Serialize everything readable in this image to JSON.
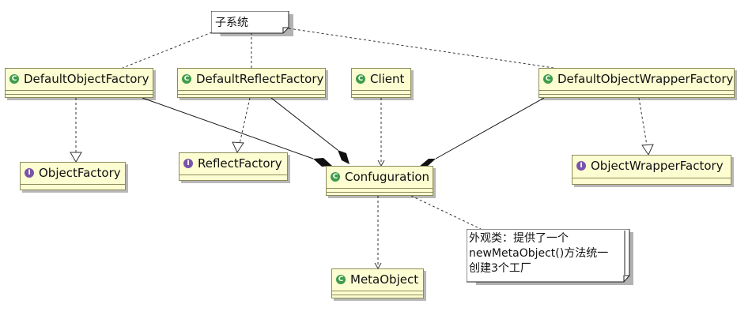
{
  "nodes": {
    "subsystem_note": "子系统",
    "default_object_factory": {
      "label": "DefaultObjectFactory",
      "kind": "class"
    },
    "default_reflect_factory": {
      "label": "DefaultReflectFactory",
      "kind": "class"
    },
    "client": {
      "label": "Client",
      "kind": "class"
    },
    "default_object_wrapper_factory": {
      "label": "DefaultObjectWrapperFactory",
      "kind": "class"
    },
    "object_factory": {
      "label": "ObjectFactory",
      "kind": "interface"
    },
    "reflect_factory": {
      "label": "ReflectFactory",
      "kind": "interface"
    },
    "configuration": {
      "label": "Confuguration",
      "kind": "class"
    },
    "object_wrapper_factory": {
      "label": "ObjectWrapperFactory",
      "kind": "interface"
    },
    "meta_object": {
      "label": "MetaObject",
      "kind": "class"
    },
    "facade_note": [
      "外观类：提供了一个",
      "newMetaObject()方法统一",
      "创建3个工厂"
    ]
  },
  "badges": {
    "class": "C",
    "interface": "I"
  },
  "colors": {
    "class_fill": "#fdfdd2",
    "class_border": "#8c8c5a",
    "class_badge": "#3e9c4a",
    "interface_badge": "#7a54a8"
  }
}
